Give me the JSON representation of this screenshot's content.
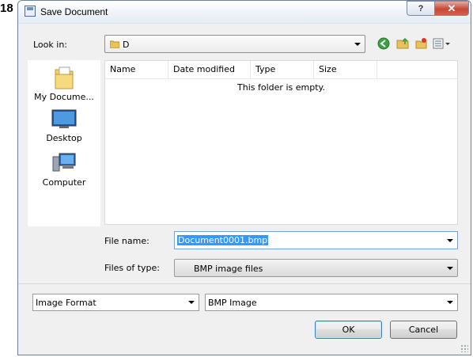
{
  "step_number": "18",
  "window": {
    "title": "Save Document",
    "help_label": "?",
    "close_label": "✕"
  },
  "look_in": {
    "label": "Look in:",
    "value": "D"
  },
  "places": [
    {
      "label": "My Docume..."
    },
    {
      "label": "Desktop"
    },
    {
      "label": "Computer"
    }
  ],
  "file_list": {
    "columns": [
      "Name",
      "Date modified",
      "Type",
      "Size"
    ],
    "empty_message": "This folder is empty."
  },
  "file_name": {
    "label": "File name:",
    "value": "Document0001.bmp"
  },
  "file_type": {
    "label": "Files of type:",
    "value": "BMP image files"
  },
  "format_category": {
    "value": "Image Format"
  },
  "format": {
    "value": "BMP Image"
  },
  "buttons": {
    "ok": "OK",
    "cancel": "Cancel"
  },
  "colors": {
    "selection": "#3399ff",
    "close_button": "#c74a36"
  }
}
